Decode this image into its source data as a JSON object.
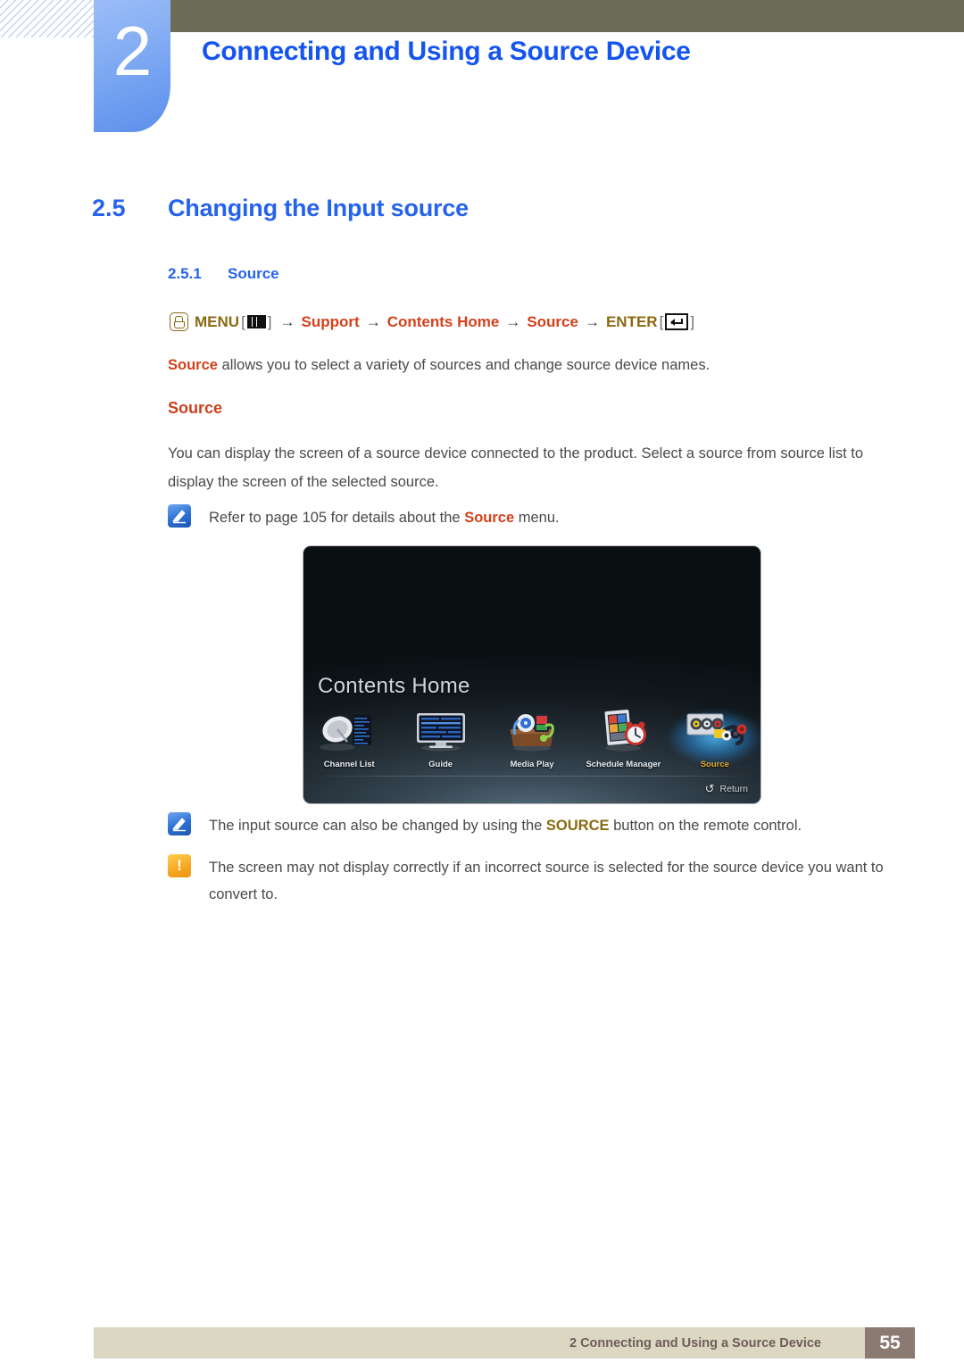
{
  "chapter": {
    "number": "2",
    "title": "Connecting and Using a Source Device"
  },
  "section": {
    "number": "2.5",
    "title": "Changing the Input source"
  },
  "subsection": {
    "number": "2.5.1",
    "title": "Source"
  },
  "menu_path": {
    "menu_label": "MENU",
    "bracket_open": "[",
    "bracket_close": "]",
    "arrow": "→",
    "step_support": "Support",
    "step_contents_home": "Contents Home",
    "step_source": "Source",
    "enter_label": "ENTER",
    "hand_icon": "hand-press-icon",
    "menu_icon": "menu-bars-icon",
    "enter_icon": "enter-return-icon"
  },
  "intro": {
    "highlight": "Source",
    "rest": " allows you to select a variety of sources and change source device names."
  },
  "source_heading": "Source",
  "body_paragraph": "You can display the screen of a source device connected to the product. Select a source from source list to display the screen of the selected source.",
  "notes": [
    {
      "icon": "note-pencil-icon",
      "pre": "Refer to page 105 for details about the ",
      "highlight": "Source",
      "post": " menu.",
      "highlight_color": "#d5401a"
    },
    {
      "icon": "note-pencil-icon",
      "pre": "The input source can also be changed by using the ",
      "highlight": "SOURCE",
      "post": " button on the remote control.",
      "highlight_color": "#8a6a12"
    },
    {
      "icon": "warning-icon",
      "pre": "The screen may not display correctly if an incorrect source is selected for the source device you want to convert to.",
      "highlight": "",
      "post": "",
      "highlight_color": ""
    }
  ],
  "tv_screen": {
    "title": "Contents Home",
    "items": [
      {
        "label": "Channel List",
        "icon": "satellite-dish-icon",
        "active": false
      },
      {
        "label": "Guide",
        "icon": "tv-guide-icon",
        "active": false
      },
      {
        "label": "Media Play",
        "icon": "media-box-icon",
        "active": false
      },
      {
        "label": "Schedule Manager",
        "icon": "schedule-clock-icon",
        "active": false
      },
      {
        "label": "Source",
        "icon": "av-connectors-icon",
        "active": true
      }
    ],
    "return_label": "Return",
    "return_icon": "return-arrow-icon",
    "active_label_color": "#f0a81e"
  },
  "footer": {
    "text": "2 Connecting and Using a Source Device",
    "page_number": "55"
  },
  "colors": {
    "heading_blue": "#2563eb",
    "accent_red": "#d5401a",
    "accent_gold": "#8a6a12",
    "olive_band": "#6d6c57",
    "footer_bar": "#dcd7c3",
    "footer_page_box": "#8a7a72",
    "chapter_tab_blue": "#8ab2f4"
  }
}
